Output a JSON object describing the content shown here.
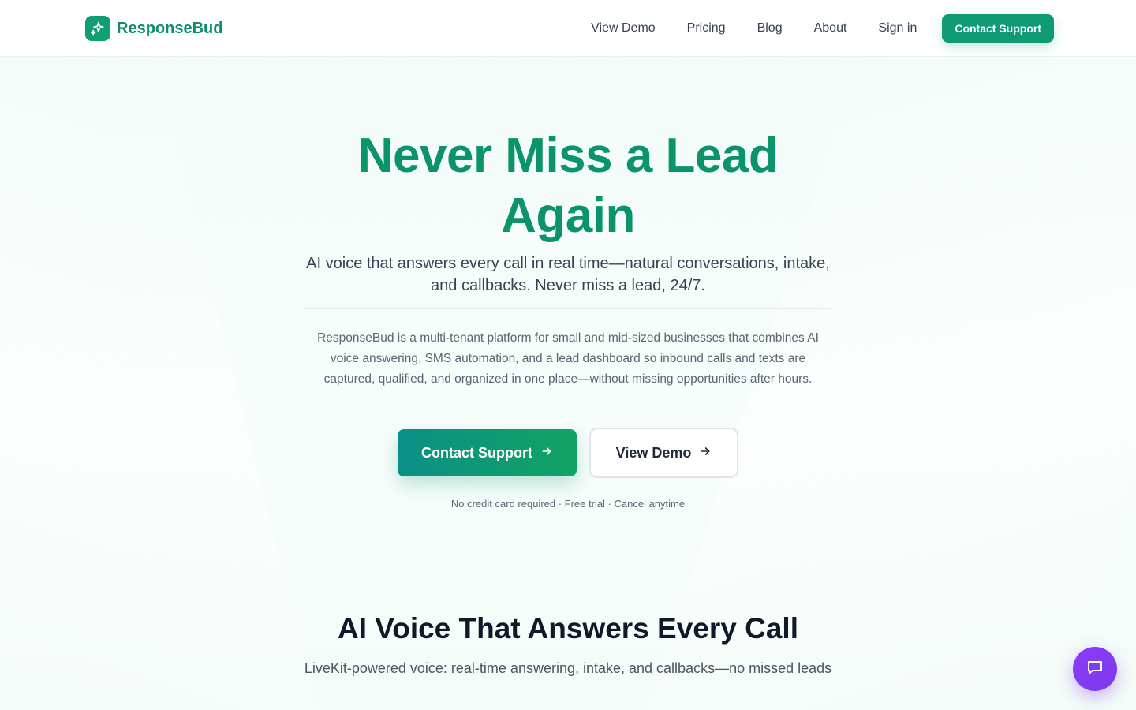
{
  "brand": {
    "name": "ResponseBud",
    "icon": "sparkles-icon",
    "accent": "#0b946c"
  },
  "nav": {
    "items": [
      "View Demo",
      "Pricing",
      "Blog",
      "About",
      "Sign in"
    ],
    "cta_label": "Contact Support"
  },
  "hero": {
    "title": "Never Miss a Lead Again",
    "subtitle": "AI voice that answers every call in real time—natural conversations, intake, and callbacks. Never miss a lead, 24/7.",
    "description": "ResponseBud is a multi-tenant platform for small and mid-sized businesses that combines AI voice answering, SMS automation, and a lead dashboard so inbound calls and texts are captured, qualified, and organized in one place—without missing opportunities after hours.",
    "primary_button": "Contact Support",
    "secondary_button": "View Demo",
    "button_icon": "arrow-right-icon",
    "fineprint": "No credit card required · Free trial · Cancel anytime"
  },
  "section": {
    "title": "AI Voice That Answers Every Call",
    "subtitle": "LiveKit-powered voice: real-time answering, intake, and callbacks—no missed leads"
  },
  "chat": {
    "icon": "chat-bubble-icon",
    "color": "#7c3aed"
  }
}
